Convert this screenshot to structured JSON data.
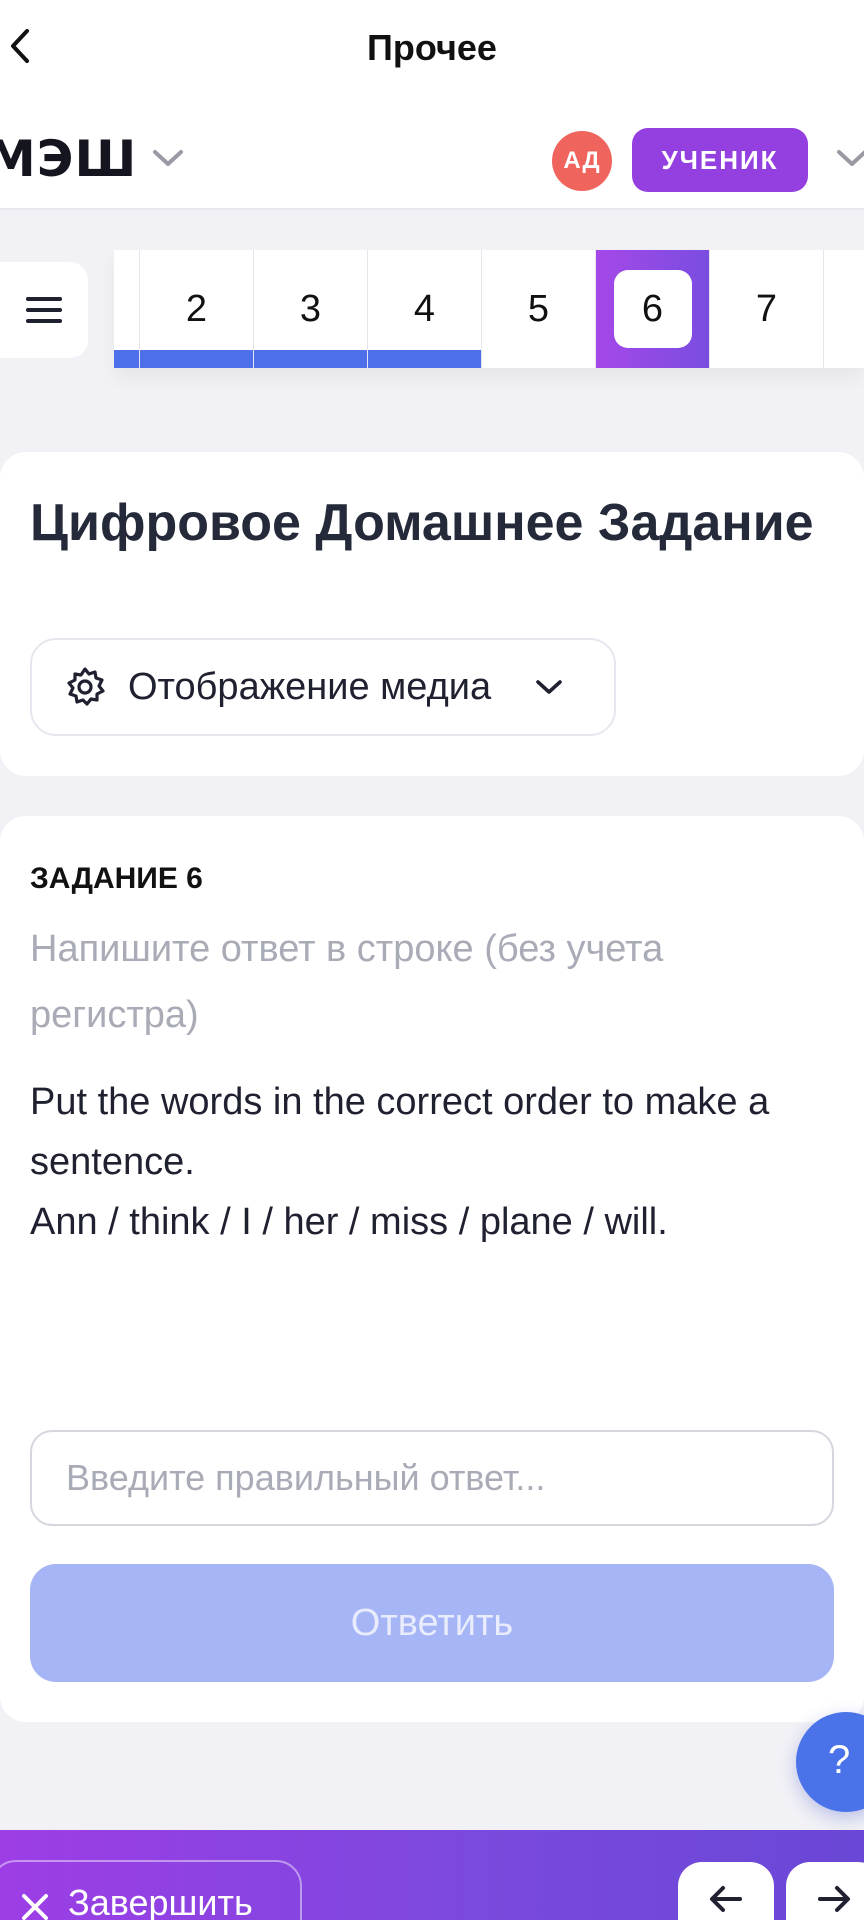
{
  "topbar": {
    "title": "Прочее"
  },
  "brand": {
    "logo": "МЭШ"
  },
  "user": {
    "avatar_initials": "АД",
    "role": "УЧЕНИК"
  },
  "questions": [
    {
      "number": "2",
      "answered": true,
      "active": false
    },
    {
      "number": "3",
      "answered": true,
      "active": false
    },
    {
      "number": "4",
      "answered": true,
      "active": false
    },
    {
      "number": "5",
      "answered": false,
      "active": false
    },
    {
      "number": "6",
      "answered": false,
      "active": true
    },
    {
      "number": "7",
      "answered": false,
      "active": false
    }
  ],
  "header": {
    "title": "Цифровое Домашнее Задание",
    "media_label": "Отображение медиа"
  },
  "task": {
    "label": "ЗАДАНИЕ 6",
    "hint": "Напишите ответ в строке (без учета регистра)",
    "text_line1": "Put the words in the correct order to make a sentence.",
    "text_line2": "Ann / think / I / her / miss / plane / will.",
    "input_placeholder": "Введите правильный ответ...",
    "input_value": "",
    "submit_label": "Ответить"
  },
  "help": {
    "label": "?"
  },
  "bottom": {
    "finish_label": "Завершить"
  },
  "colors": {
    "accent_purple": "#9440e0",
    "progress_blue": "#4d70ea",
    "submit_disabled": "#a6b5f6",
    "avatar_red": "#f0645e"
  },
  "icons": {
    "back": "chevron-left-icon",
    "menu": "hamburger-icon",
    "media": "gear-icon",
    "dropdown": "chevron-down-icon",
    "close": "close-icon",
    "prev": "arrow-left-icon",
    "next": "arrow-right-icon"
  }
}
